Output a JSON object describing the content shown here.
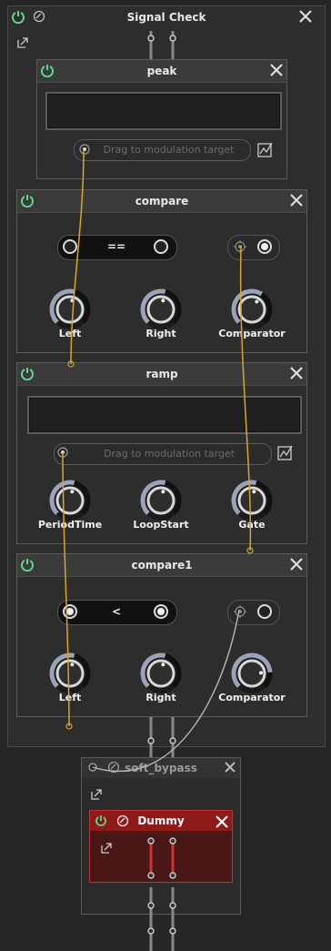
{
  "outer": {
    "title": "Signal Check"
  },
  "peak": {
    "title": "peak",
    "drag_placeholder": "Drag to modulation target"
  },
  "compare": {
    "title": "compare",
    "operator": "==",
    "knobs": [
      {
        "label": "Left",
        "value": 0.55
      },
      {
        "label": "Right",
        "value": 0.55
      },
      {
        "label": "Comparator",
        "value": 0.62
      }
    ]
  },
  "ramp": {
    "title": "ramp",
    "drag_placeholder": "Drag to modulation target",
    "knobs": [
      {
        "label": "PeriodTime",
        "value": 0.55
      },
      {
        "label": "LoopStart",
        "value": 0.55
      },
      {
        "label": "Gate",
        "value": 0.55
      }
    ]
  },
  "compare1": {
    "title": "compare1",
    "operator": "<",
    "knobs": [
      {
        "label": "Left",
        "value": 0.55
      },
      {
        "label": "Right",
        "value": 0.55
      },
      {
        "label": "Comparator",
        "value": 0.82
      }
    ]
  },
  "soft_bypass": {
    "title": "soft_bypass"
  },
  "dummy": {
    "title": "Dummy"
  },
  "colors": {
    "power_green": "#5fd68a",
    "cable_gold": "#d9a62a",
    "cable_grey": "#b8b8b8",
    "dummy_red": "#8e1a1a"
  }
}
